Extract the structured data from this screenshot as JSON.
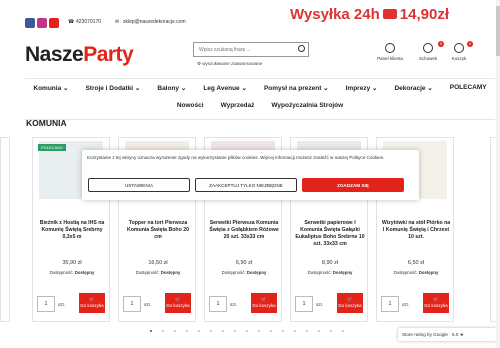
{
  "promo": {
    "label": "Wysyłka 24h",
    "price": "14,90zł"
  },
  "contact": {
    "phone": "423070170",
    "email": "sklep@naszedekoracje.com"
  },
  "logo": {
    "part1": "Nasze",
    "part2": "Party"
  },
  "search": {
    "placeholder": "Wpisz szukaną frazę ...",
    "advanced": "wyszukiwanie zaawansowane"
  },
  "header_icons": [
    {
      "label": "Panel klienta",
      "icon": "user-icon"
    },
    {
      "label": "Schowek",
      "icon": "heart-icon",
      "count": "0"
    },
    {
      "label": "Koszyk",
      "icon": "cart-icon",
      "count": "0"
    }
  ],
  "nav": {
    "row1": [
      "Komunia ⌄",
      "Stroje i Dodatki ⌄",
      "Balony ⌄",
      "Leg Avenue ⌄",
      "Pomysł na prezent ⌄",
      "Imprezy ⌄",
      "Dekoracje ⌄",
      "POLECAMY"
    ],
    "row2": [
      "Nowości",
      "Wyprzedaż",
      "Wypożyczalnia Strojów"
    ]
  },
  "section_title": "KOMUNIA",
  "products": [
    {
      "badge": "POLECAMY",
      "name": "Bieżnik z Hostią na IHS na Komunię Świętą Srebrny 0,3x5 m",
      "price": "35,90 zł",
      "availability_label": "Dostępność:",
      "availability": "Dostępny",
      "qty": "1",
      "unit": "szt.",
      "add": "Do koszyka"
    },
    {
      "badge": "",
      "name": "Topper na tort Pierwsza Komunia Święta Boho 20 cm",
      "price": "16,50 zł",
      "availability_label": "Dostępność:",
      "availability": "Dostępny",
      "qty": "1",
      "unit": "szt.",
      "add": "Do koszyka"
    },
    {
      "badge": "",
      "name": "Serwetki Pierwsza Komunia Święta z Gołąbkiem Różowe 20 szt. 33x33 cm",
      "price": "6,90 zł",
      "availability_label": "Dostępność:",
      "availability": "Dostępny",
      "qty": "1",
      "unit": "szt.",
      "add": "Do koszyka"
    },
    {
      "badge": "",
      "name": "Serwetki papierowe I Komunia Święta Gałązki Eukaliptus Boho Srebrne 10 szt. 33x33 cm",
      "price": "8,90 zł",
      "availability_label": "Dostępność:",
      "availability": "Dostępny",
      "qty": "1",
      "unit": "szt.",
      "add": "Do koszyka"
    },
    {
      "badge": "",
      "name": "Wizytówki na stół Piórko na I Komunię Świętą i Chrzest 10 szt.",
      "price": "6,50 zł",
      "availability_label": "Dostępność:",
      "availability": "Dostępny",
      "qty": "1",
      "unit": "szt.",
      "add": "Do koszyka"
    }
  ],
  "cookie": {
    "text": "Korzystanie z tej witryny oznacza wyrażenie zgody na wykorzystanie plików cookies. Więcej informacji możesz znaleźć w naszej Polityce Cookies.",
    "settings": "USTAWIENIA",
    "necessary": "ZAAKCEPTUJ TYLKO NIEZBĘDNE",
    "accept": "ZGADZAM SIĘ"
  },
  "rating": "Store rating by Google · 5.0 ★"
}
